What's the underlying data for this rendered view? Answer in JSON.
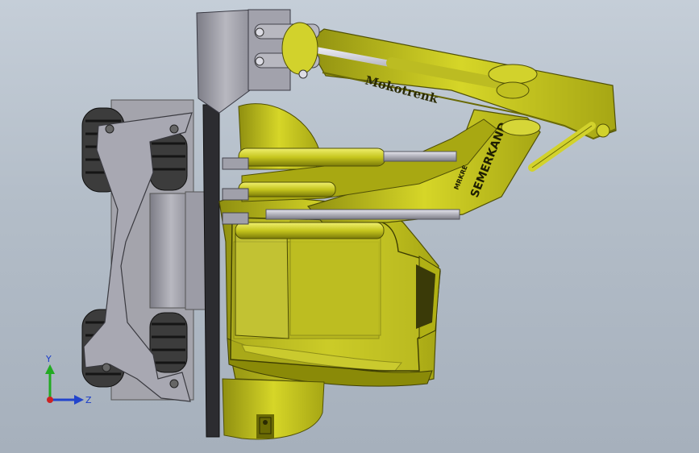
{
  "viewport": {
    "background_top": "#c5ced8",
    "background_bottom": "#a6b0bc"
  },
  "model": {
    "boom_decal": "Mokotrenk",
    "arm_decal": "SEMERKAND",
    "arm_sub_decal": "MRKRE",
    "body_color": "#c8c81e",
    "body_shade": "#8c8c0c",
    "metal_color": "#9b9ba4"
  },
  "triad": {
    "y_label": "Y",
    "z_label": "Z",
    "y_color": "#22aa22",
    "z_color": "#2244cc",
    "x_color": "#cc2222"
  }
}
